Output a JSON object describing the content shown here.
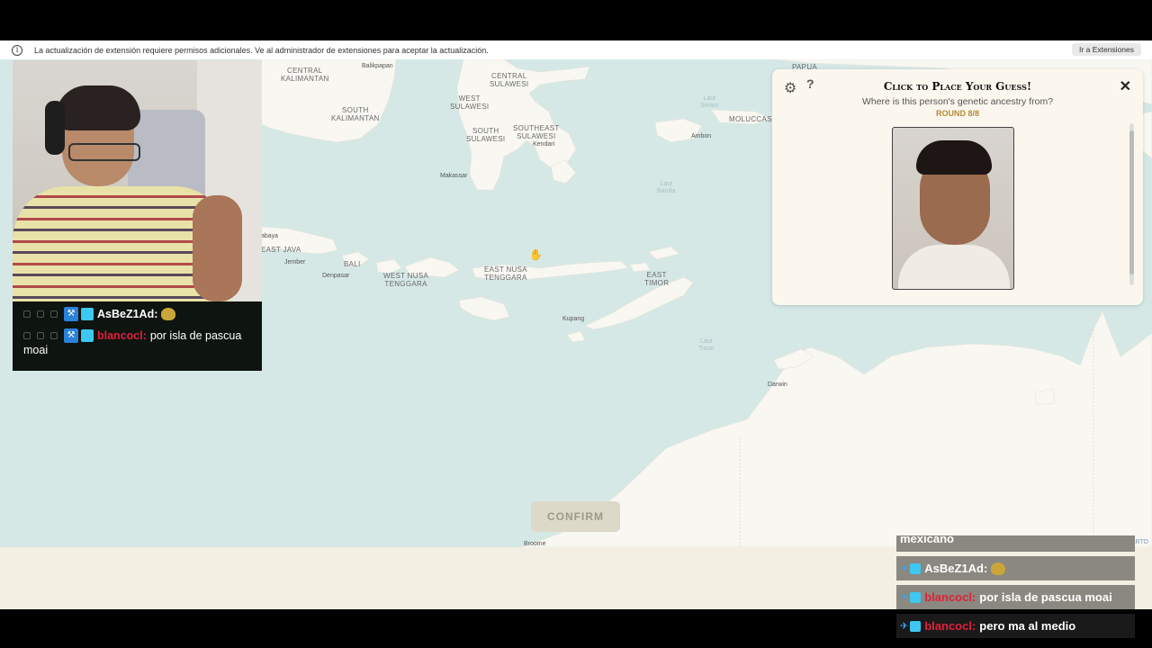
{
  "extension_bar": {
    "message": "La actualización de extensión requiere permisos adicionales. Ve al administrador de extensiones para aceptar la actualización.",
    "button_label": "Ir a Extensiones",
    "icon": "info-icon"
  },
  "map": {
    "regions": [
      {
        "id": "central-kalimantan",
        "text": "CENTRAL\nKALIMANTAN"
      },
      {
        "id": "south-kalimantan",
        "text": "SOUTH\nKALIMANTAN"
      },
      {
        "id": "central-sulawesi",
        "text": "CENTRAL\nSULAWESI"
      },
      {
        "id": "west-sulawesi",
        "text": "WEST\nSULAWESI"
      },
      {
        "id": "south-sulawesi",
        "text": "SOUTH\nSULAWESI"
      },
      {
        "id": "southeast-sulawesi",
        "text": "SOUTHEAST\nSULAWESI"
      },
      {
        "id": "moluccas",
        "text": "MOLUCCAS"
      },
      {
        "id": "east-java",
        "text": "EAST JAVA"
      },
      {
        "id": "bali",
        "text": "BALI"
      },
      {
        "id": "west-nusa-tenggara",
        "text": "WEST NUSA\nTENGGARA"
      },
      {
        "id": "east-nusa-tenggara",
        "text": "EAST NUSA\nTENGGARA"
      },
      {
        "id": "east-timor",
        "text": "EAST\nTIMOR"
      },
      {
        "id": "papua",
        "text": "PAPUA"
      }
    ],
    "cities": [
      "Balikpapan",
      "Kendari",
      "Makassar",
      "Ambon",
      "Jember",
      "Denpasar",
      "Kupang",
      "Darwin",
      "Broome",
      "abaya"
    ],
    "seas": [
      "Laut\nSeram",
      "Laut\nBanda",
      "Laut\nTimor"
    ],
    "confirm_label": "CONFIRM",
    "attribution": "Leaflet | © OSM © CARTO",
    "land_color": "#f8f7f2",
    "water_color": "#d5e8e6"
  },
  "guess_panel": {
    "title": "Click to Place Your Guess!",
    "subtitle": "Where is this person's genetic ancestry from?",
    "round": "ROUND 8/8",
    "gear_icon": "gear-icon",
    "help_label": "?",
    "close_label": "✕"
  },
  "chat_left": [
    {
      "user": "AsBeZ1Ad:",
      "user_color": "#ffffff",
      "message": ""
    },
    {
      "user": "blancocl:",
      "user_color": "#e0213a",
      "message": "por isla de pascua",
      "continuation": "moai"
    }
  ],
  "chat_right": {
    "cut_text": "mexicano",
    "messages": [
      {
        "user": "AsBeZ1Ad:",
        "message": "",
        "style": "gray"
      },
      {
        "user": "blancocl:",
        "message": "por isla de pascua moai",
        "style": "gray"
      },
      {
        "user": "blancocl:",
        "message": "pero ma al medio",
        "style": "dark"
      }
    ]
  }
}
